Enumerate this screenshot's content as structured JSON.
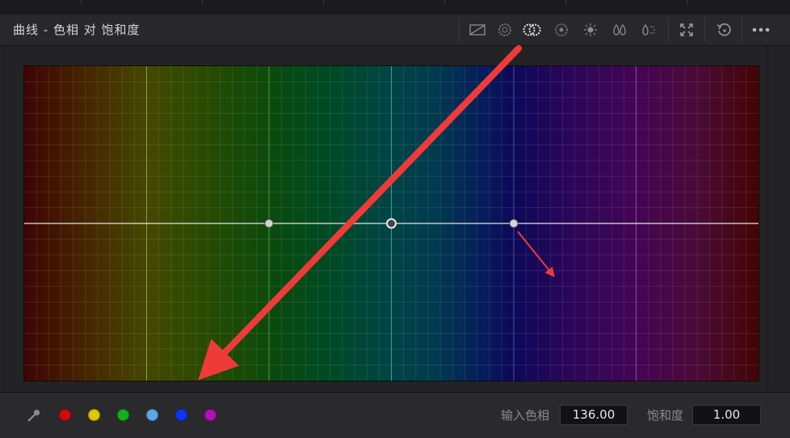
{
  "header": {
    "title": "曲线 - 色相 对 饱和度"
  },
  "toolbar": {
    "modes": [
      {
        "icon": "curve-custom-icon"
      },
      {
        "icon": "hue-vs-hue-icon"
      },
      {
        "icon": "hue-vs-sat-icon",
        "active": true
      },
      {
        "icon": "hue-vs-lum-icon"
      },
      {
        "icon": "lum-vs-sat-icon"
      },
      {
        "icon": "sat-vs-sat-icon"
      },
      {
        "icon": "sat-vs-lum-icon"
      }
    ],
    "actions": [
      {
        "icon": "expand-icon"
      },
      {
        "icon": "reset-icon"
      },
      {
        "icon": "more-options-icon"
      }
    ]
  },
  "curve": {
    "control_points_hue": [
      120,
      180,
      240
    ],
    "selected_point_index": 1,
    "saturation_level": 1.0,
    "hue_bands": [
      "red",
      "yellow",
      "green",
      "cyan",
      "blue",
      "magenta"
    ]
  },
  "swatches": [
    {
      "name": "red",
      "color": "#d10b0b"
    },
    {
      "name": "yellow",
      "color": "#e3c600"
    },
    {
      "name": "green",
      "color": "#17b01d"
    },
    {
      "name": "cyan",
      "color": "#5aa8ea"
    },
    {
      "name": "blue",
      "color": "#0a35ff"
    },
    {
      "name": "magenta",
      "color": "#b40fb4"
    }
  ],
  "inputs": {
    "input_hue_label": "输入色相",
    "input_hue_value": "136.00",
    "saturation_label": "饱和度",
    "saturation_value": "1.00"
  },
  "colors": {
    "accent_arrow": "#f03a3a",
    "curve_line": "#e6e6e6"
  }
}
